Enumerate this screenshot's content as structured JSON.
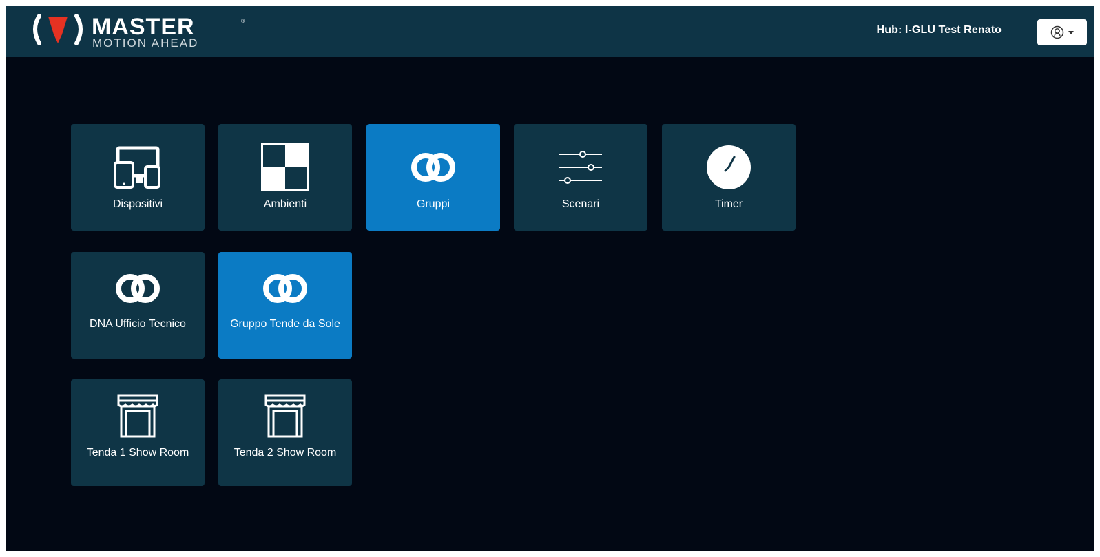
{
  "header": {
    "brand": {
      "name": "MASTER",
      "tagline": "MOTION AHEAD"
    },
    "hub_label": "Hub: I-GLU Test Renato",
    "user_menu_icon": "user-circle-icon"
  },
  "colors": {
    "header_bg": "#0e3446",
    "page_bg": "#020814",
    "tile_bg": "#0f3546",
    "tile_active_bg": "#0b7bc4",
    "logo_red": "#e63222"
  },
  "tiles": [
    {
      "label": "Dispositivi",
      "icon": "devices-icon",
      "active": false
    },
    {
      "label": "Ambienti",
      "icon": "rooms-icon",
      "active": false
    },
    {
      "label": "Gruppi",
      "icon": "groups-rings-icon",
      "active": true
    },
    {
      "label": "Scenari",
      "icon": "sliders-icon",
      "active": false
    },
    {
      "label": "Timer",
      "icon": "clock-icon",
      "active": false
    },
    {
      "label": "DNA Ufficio Tecnico",
      "icon": "groups-rings-icon",
      "active": false
    },
    {
      "label": "Gruppo Tende da Sole",
      "icon": "groups-rings-icon",
      "active": true
    },
    {
      "label": "Tenda 1 Show Room",
      "icon": "awning-icon",
      "active": false
    },
    {
      "label": "Tenda 2 Show Room",
      "icon": "awning-icon",
      "active": false
    }
  ]
}
